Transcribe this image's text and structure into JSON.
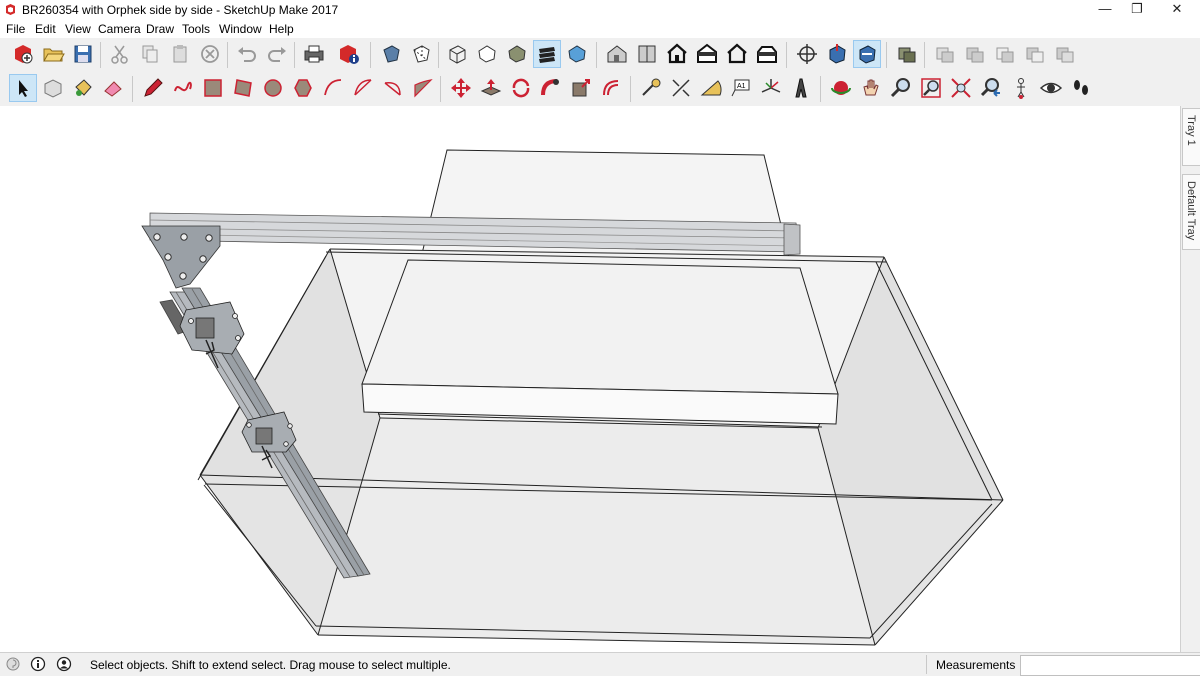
{
  "window": {
    "title": "BR260354 with Orphek side by side - SketchUp Make 2017",
    "minimize_glyph": "—",
    "restore_glyph": "❐",
    "close_glyph": "✕"
  },
  "menu": [
    "File",
    "Edit",
    "View",
    "Camera",
    "Draw",
    "Tools",
    "Window",
    "Help"
  ],
  "toolbar_top": {
    "file": [
      "new-model-icon",
      "open-icon",
      "save-icon"
    ],
    "edit": [
      "cut-icon",
      "copy-icon",
      "paste-icon",
      "erase-icon",
      "undo-icon",
      "redo-icon",
      "print-icon",
      "model-info-icon"
    ],
    "styles": [
      "xray-icon",
      "wireframe-icon",
      "hidden-line-icon",
      "shaded-icon",
      "shaded-textures-icon",
      "monochrome-icon"
    ],
    "views": [
      "iso-view-icon",
      "top-view-icon",
      "front-view-icon",
      "right-view-icon",
      "back-view-icon",
      "left-view-icon"
    ],
    "sections": [
      "section-plane-icon",
      "display-section-planes-icon",
      "display-section-cuts-icon"
    ],
    "solids": [
      "outer-shell-icon",
      "intersect-icon",
      "union-icon",
      "subtract-icon",
      "trim-icon",
      "split-icon"
    ]
  },
  "toolbar_bottom": {
    "principal": [
      "select-icon",
      "make-component-icon",
      "paint-bucket-icon",
      "eraser-icon"
    ],
    "draw": [
      "pencil-icon",
      "freehand-icon",
      "rectangle-icon",
      "rotated-rectangle-icon",
      "circle-icon",
      "polygon-icon",
      "arc-icon",
      "two-point-arc-icon",
      "three-point-arc-icon",
      "pie-icon"
    ],
    "edit": [
      "move-icon",
      "push-pull-icon",
      "rotate-icon",
      "follow-me-icon",
      "scale-icon",
      "offset-icon"
    ],
    "construction": [
      "tape-measure-icon",
      "dimension-icon",
      "protractor-icon",
      "text-icon",
      "axes-icon",
      "3d-text-icon"
    ],
    "camera": [
      "orbit-icon",
      "pan-icon",
      "zoom-icon",
      "zoom-window-icon",
      "zoom-extents-icon",
      "previous-view-icon",
      "position-camera-icon",
      "look-around-icon",
      "walk-icon"
    ]
  },
  "tray": {
    "tabs": [
      "Tray 1",
      "Default Tray"
    ]
  },
  "status": {
    "icons": [
      "geo-location-icon",
      "credits-icon",
      "user-account-icon"
    ],
    "message": "Select objects. Shift to extend select. Drag mouse to select multiple.",
    "measurements_label": "Measurements",
    "measurements_value": ""
  },
  "colors": {
    "accent_selected": "#cde6f7",
    "viewport_bg": "#ffffff",
    "chrome_bg": "#f0f0f0"
  }
}
